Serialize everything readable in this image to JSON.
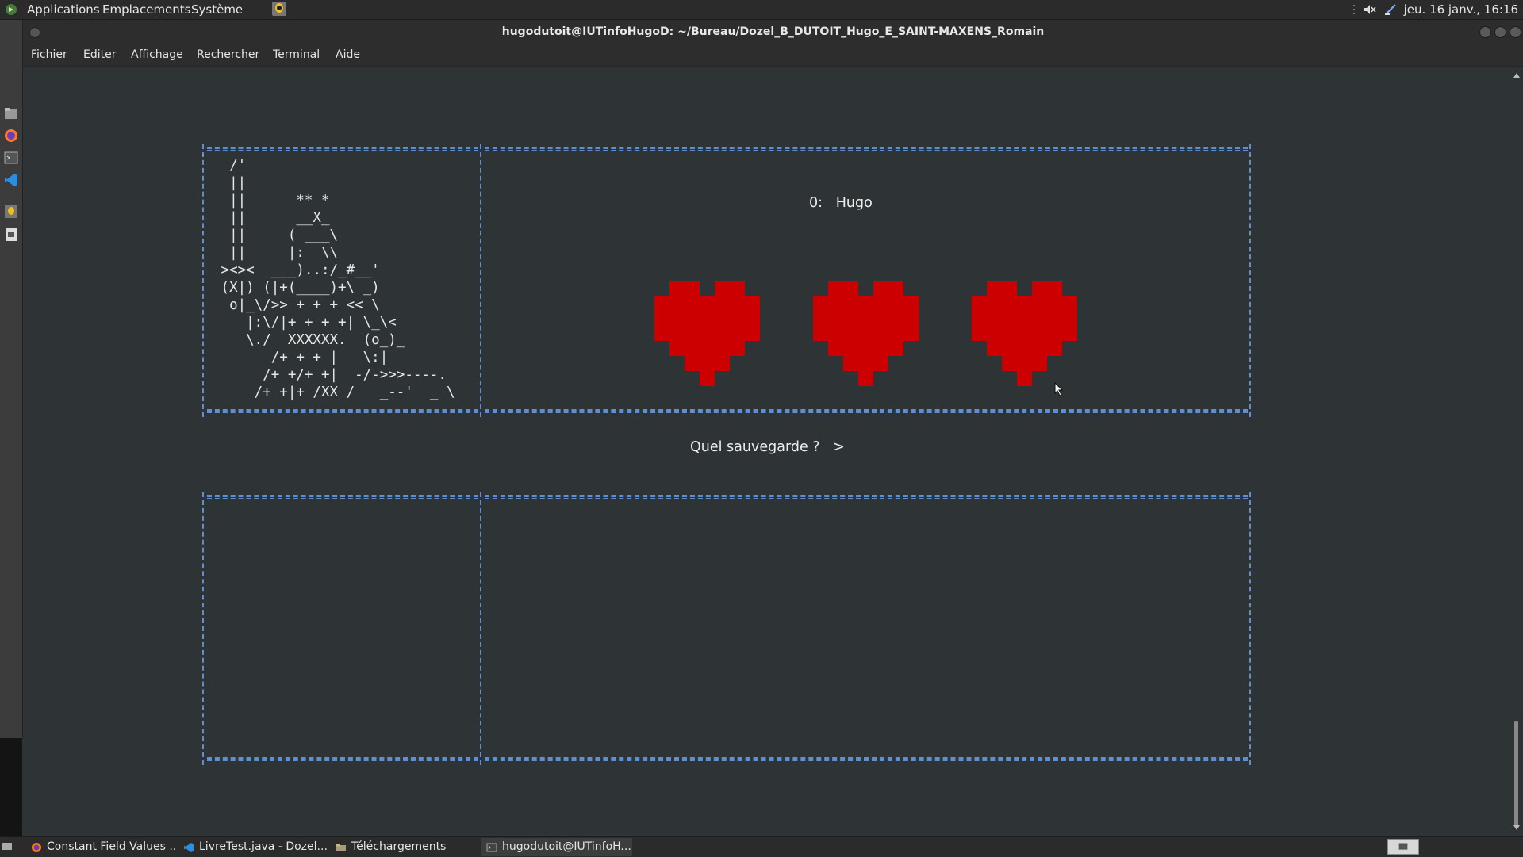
{
  "top_panel": {
    "applications": "Applications",
    "places": "Emplacements",
    "system": "Système",
    "clock": "jeu. 16 janv., 16:16"
  },
  "window": {
    "title": "hugodutoit@IUTinfoHugoD: ~/Bureau/Dozel_B_DUTOIT_Hugo_E_SAINT-MAXENS_Romain"
  },
  "menubar": {
    "items": [
      "Fichier",
      "Editer",
      "Affichage",
      "Rechercher",
      "Terminal",
      "Aide"
    ]
  },
  "terminal": {
    "ascii_art": "  /'\n  ||\n  ||      ** *\n  ||      __X_\n  ||     ( ___\\\n  ||     |:  \\\\\n ><><  ___)..:/_#__'\n (X|) (|+(____)+\\ _)\n  o|_\\/>> + + + << \\\n    |:\\/|+ + + +| \\_\\<\n    \\./  XXXXXX.  (o_)_\n       /+ + + |   \\:|\n      /+ +/+ +|  -/->>>----.\n     /+ +|+ /XX /   _--'  _ \\",
    "save_slot": "0:   Hugo",
    "prompt": "Quel sauvegarde ?   >",
    "hearts": 3,
    "heart_color": "#cc0000",
    "frame_color": "#5f8fcf"
  },
  "taskbar": {
    "tasks": [
      {
        "label": "Constant Field Values ...",
        "icon": "firefox-icon"
      },
      {
        "label": "LivreTest.java - Dozel...",
        "icon": "vscode-icon"
      },
      {
        "label": "Téléchargements",
        "icon": "folder-icon"
      },
      {
        "label": "hugodutoit@IUTinfoH...",
        "icon": "terminal-icon",
        "active": true
      }
    ]
  }
}
